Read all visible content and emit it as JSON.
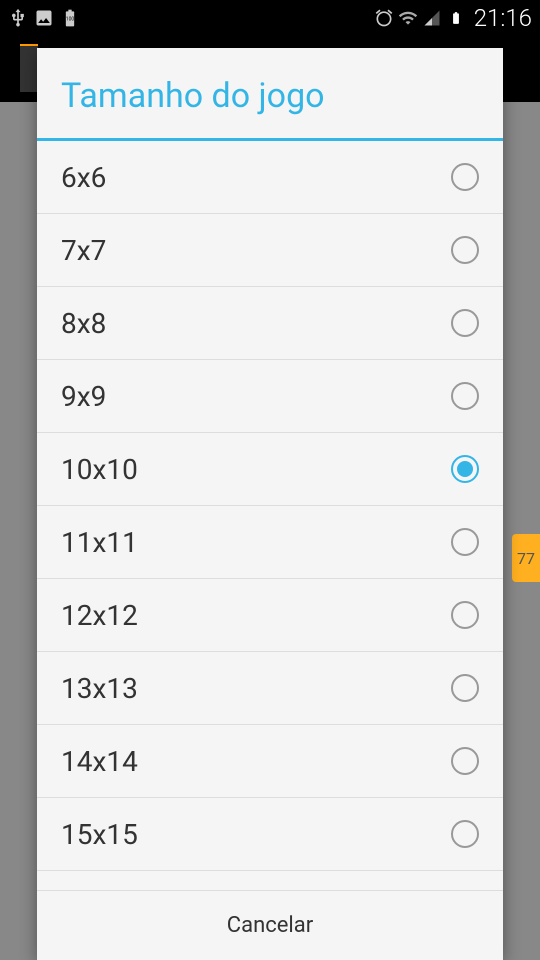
{
  "status": {
    "time": "21:16",
    "battery_text": "100"
  },
  "background": {
    "badge": "77"
  },
  "dialog": {
    "title": "Tamanho do jogo",
    "options": [
      {
        "label": "6x6",
        "selected": false
      },
      {
        "label": "7x7",
        "selected": false
      },
      {
        "label": "8x8",
        "selected": false
      },
      {
        "label": "9x9",
        "selected": false
      },
      {
        "label": "10x10",
        "selected": true
      },
      {
        "label": "11x11",
        "selected": false
      },
      {
        "label": "12x12",
        "selected": false
      },
      {
        "label": "13x13",
        "selected": false
      },
      {
        "label": "14x14",
        "selected": false
      },
      {
        "label": "15x15",
        "selected": false
      }
    ],
    "cancel_label": "Cancelar"
  }
}
